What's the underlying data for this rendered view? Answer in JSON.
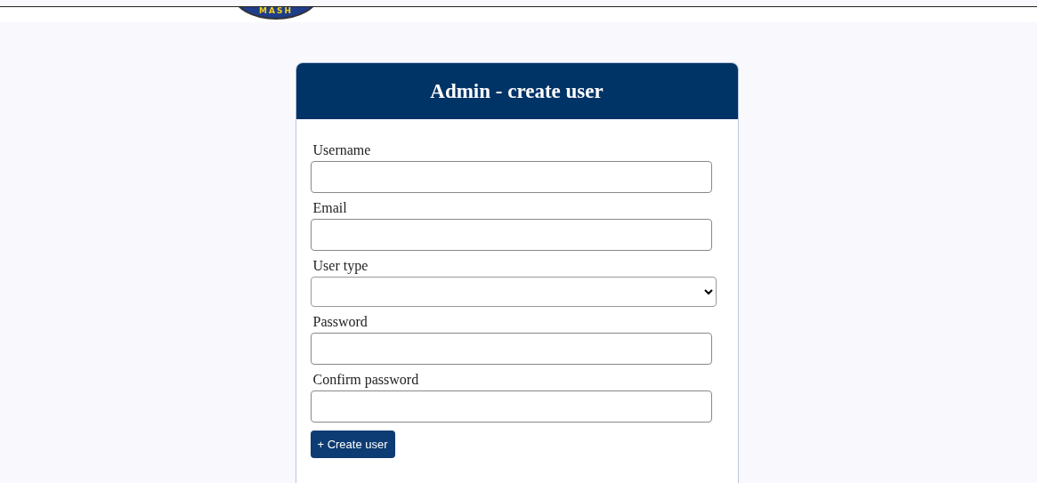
{
  "logo": {
    "text": "MASH"
  },
  "form": {
    "title": "Admin - create user",
    "fields": [
      {
        "label": "Username",
        "kind": "text"
      },
      {
        "label": "Email",
        "kind": "text"
      },
      {
        "label": "User type",
        "kind": "select"
      },
      {
        "label": "Password",
        "kind": "text"
      },
      {
        "label": "Confirm password",
        "kind": "text"
      }
    ],
    "submit_button": "+ Create user"
  }
}
